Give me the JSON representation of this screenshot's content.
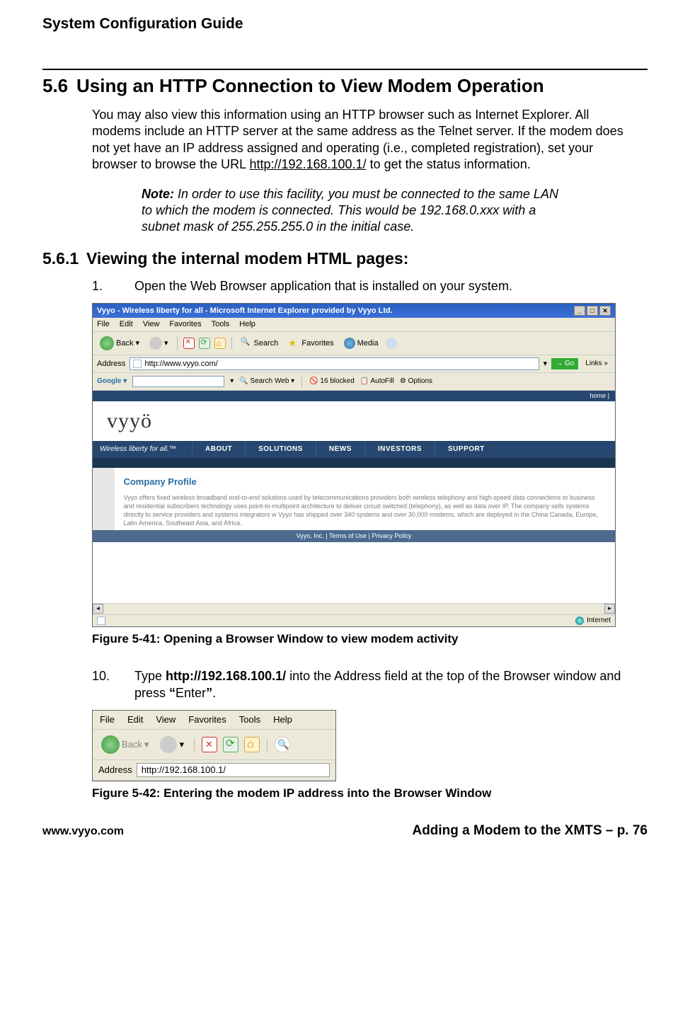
{
  "doc_title": "System Configuration Guide",
  "section": {
    "num": "5.6",
    "title": "Using an HTTP Connection to View Modem Operation",
    "para1a": "You may also view this information using an HTTP browser such as Internet Explorer.  All modems include an HTTP server at the same address as the Telnet server.  If the modem does not yet have an IP address assigned and operating (i.e., completed registration), set your browser to browse the URL ",
    "url": "http://192.168.100.1/",
    "para1b": " to get the status information.",
    "note_label": "Note:",
    "note_text": " In order to use this facility, you must be connected to the same LAN to which the modem is connected.  This would be 192.168.0.xxx with a subnet mask of 255.255.255.0 in the initial case."
  },
  "subsection": {
    "num": "5.6.1",
    "title": "Viewing the internal modem HTML pages:",
    "step1_num": "1.",
    "step1_text": "Open the Web Browser application that is installed on your system.",
    "step2_num": "10.",
    "step2_a": "Type ",
    "step2_url": "http://192.168.100.1/",
    "step2_b": " into the Address field at the top of the Browser window and press ",
    "step2_q1": "“",
    "step2_enter": "Enter",
    "step2_q2": "”",
    "step2_dot": "."
  },
  "fig1_caption": "Figure 5-41: Opening a Browser Window to view modem activity",
  "fig2_caption": "Figure 5-42:  Entering the modem IP address into the Browser Window",
  "ie1": {
    "title": "Vyyo - Wireless liberty for all - Microsoft Internet Explorer provided by Vyyo Ltd.",
    "menu": [
      "File",
      "Edit",
      "View",
      "Favorites",
      "Tools",
      "Help"
    ],
    "back": "Back",
    "search": "Search",
    "favorites": "Favorites",
    "media": "Media",
    "addr_label": "Address",
    "addr_value": "http://www.vyyo.com/",
    "go": "Go",
    "links": "Links",
    "google": "Google",
    "gsearch": "Search Web",
    "gblocked": "16 blocked",
    "gautofill": "AutoFill",
    "goptions": "Options",
    "home_link": "home |",
    "logo": "vyyö",
    "slogan": "Wireless liberty for all.™",
    "nav": [
      "ABOUT",
      "SOLUTIONS",
      "NEWS",
      "INVESTORS",
      "SUPPORT"
    ],
    "profile_h": "Company Profile",
    "profile_p": "Vyyo offers fixed wireless broadband end-to-end solutions used by telecommunications providers both wireless telephony and high-speed data connections to business and residential subscribers technology uses point-to-multipoint architecture to deliver circuit switched (telephony), as well as data over IP. The company sells systems directly to service providers and systems integrators w Vyyo has shipped over 340 systems and over 30,000 modems, which are deployed in the China Canada, Europe, Latin America, Southeast Asia, and Africa.",
    "foot": "Vyyo, Inc. | Terms of Use | Privacy Policy",
    "zone": "Internet"
  },
  "ie2": {
    "menu": [
      "File",
      "Edit",
      "View",
      "Favorites",
      "Tools",
      "Help"
    ],
    "back": "Back",
    "addr_label": "Address",
    "addr_value": "http://192.168.100.1/"
  },
  "footer": {
    "left": "www.vyyo.com",
    "right": "Adding a Modem to the XMTS – p. 76"
  }
}
